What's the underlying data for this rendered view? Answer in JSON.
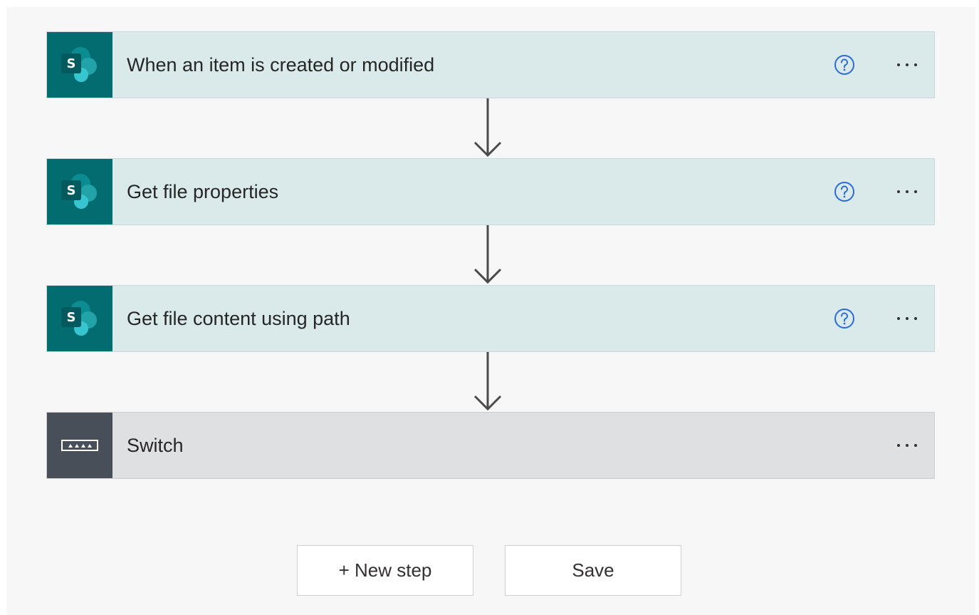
{
  "flow": {
    "steps": [
      {
        "title": "When an item is created or modified",
        "connector": "SharePoint",
        "icon": "sharepoint-icon",
        "has_help": true
      },
      {
        "title": "Get file properties",
        "connector": "SharePoint",
        "icon": "sharepoint-icon",
        "has_help": true
      },
      {
        "title": "Get file content using path",
        "connector": "SharePoint",
        "icon": "sharepoint-icon",
        "has_help": true
      },
      {
        "title": "Switch",
        "connector": "Control",
        "icon": "switch-icon",
        "has_help": false
      }
    ]
  },
  "actions": {
    "new_step_label": "+ New step",
    "save_label": "Save"
  },
  "colors": {
    "sharepoint_icon_bg": "#036c70",
    "sharepoint_card_bg": "#dae9ea",
    "switch_icon_bg": "#484f58",
    "switch_card_bg": "#dfe0e2",
    "help_icon": "#2b6cd9",
    "canvas_bg": "#f7f7f7"
  }
}
